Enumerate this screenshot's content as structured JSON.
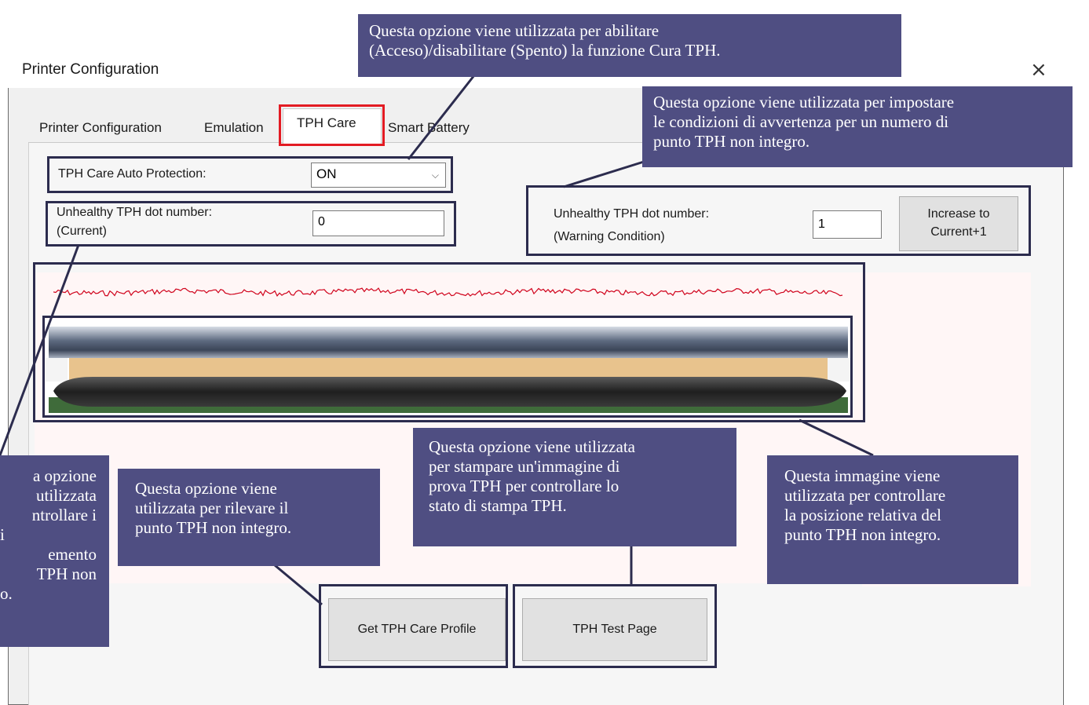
{
  "window": {
    "title": "Printer Configuration",
    "close_glyph": "×"
  },
  "tabs": [
    {
      "label": "Printer Configuration",
      "active": false
    },
    {
      "label": "Emulation",
      "active": false
    },
    {
      "label": "TPH Care",
      "active": true
    },
    {
      "label": "Smart Battery",
      "active": false
    }
  ],
  "auto_protection": {
    "label": "TPH Care Auto Protection:",
    "value": "ON"
  },
  "unhealthy_current": {
    "label_line1": "Unhealthy TPH dot number:",
    "label_line2": "(Current)",
    "value": "0"
  },
  "unhealthy_warning": {
    "label_line1": "Unhealthy TPH dot number:",
    "label_line2": "(Warning Condition)",
    "value": "1",
    "button_line1": "Increase to",
    "button_line2": "Current+1"
  },
  "buttons": {
    "get_profile": "Get TPH Care Profile",
    "test_page": "TPH Test Page"
  },
  "callouts": {
    "auto_protection_line1": "Questa opzione viene utilizzata per abilitare",
    "auto_protection_line2": "(Acceso)/disabilitare (Spento) la funzione Cura TPH.",
    "warning_line1": "Questa opzione viene utilizzata per impostare",
    "warning_line2": "le condizioni di avvertenza per un numero di",
    "warning_line3": "punto TPH non integro.",
    "current_line1": "a opzione",
    "current_line2": "utilizzata",
    "current_line3": "ntrollare i",
    "current_line4": "i",
    "current_line5": "emento",
    "current_line6": "TPH non",
    "current_line7": "o.",
    "profile_line1": "Questa opzione viene",
    "profile_line2": "utilizzata per rilevare il",
    "profile_line3": "punto TPH non integro.",
    "testpage_line1": "Questa opzione viene utilizzata",
    "testpage_line2": "per stampare un'immagine di",
    "testpage_line3": "prova TPH per controllare lo",
    "testpage_line4": "stato di stampa TPH.",
    "image_line1": "Questa immagine viene",
    "image_line2": "utilizzata per controllare",
    "image_line3": "la posizione relativa del",
    "image_line4": "punto TPH non integro."
  },
  "colors": {
    "callout_bg": "#4f4e82",
    "highlight": "#e31b23",
    "wave": "#d0021b"
  },
  "icons": {
    "close": "close-icon",
    "dropdown": "chevron-down-icon"
  }
}
